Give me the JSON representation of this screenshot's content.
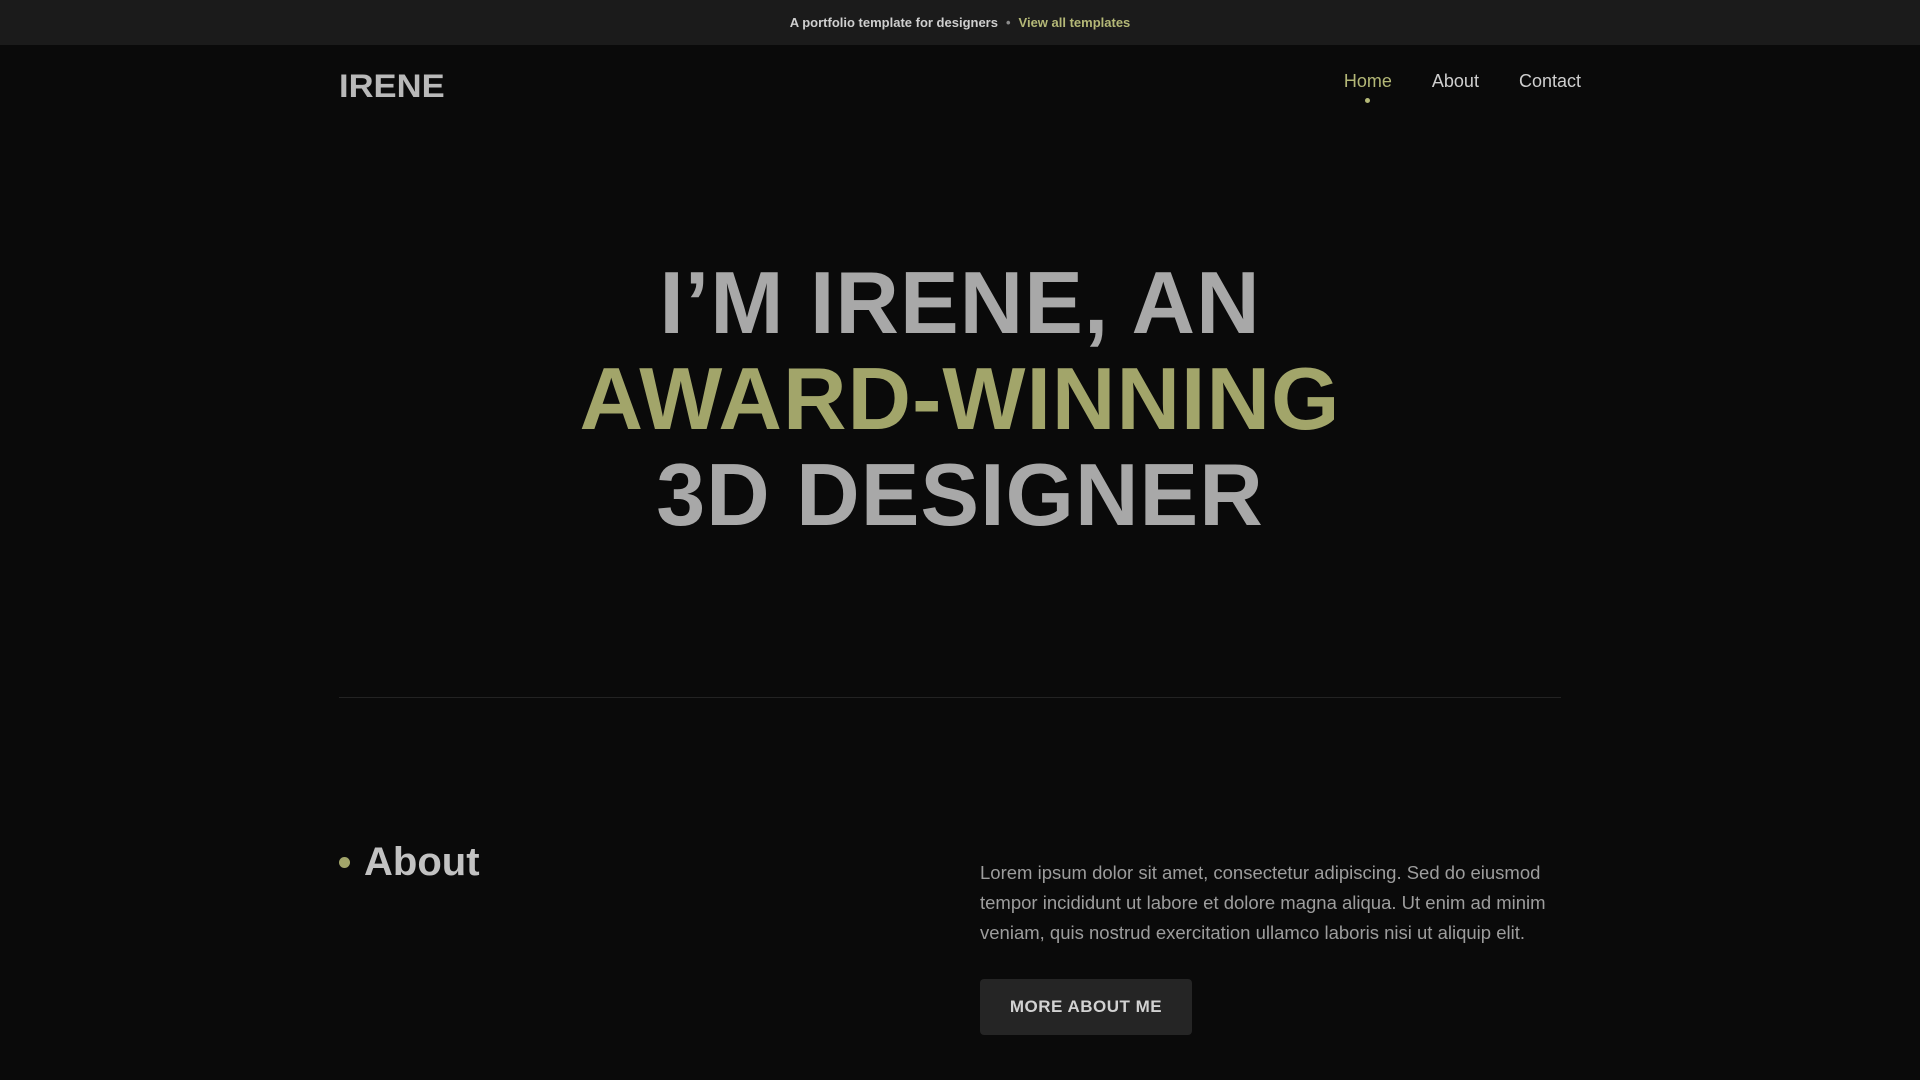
{
  "topbar": {
    "message": "A portfolio template for designers",
    "separator": "•",
    "link_label": "View all templates"
  },
  "header": {
    "logo": "IRENE",
    "nav": [
      {
        "label": "Home",
        "active": true
      },
      {
        "label": "About",
        "active": false
      },
      {
        "label": "Contact",
        "active": false
      }
    ]
  },
  "hero": {
    "line1": "I’M IRENE, AN",
    "line2": "AWARD-WINNING",
    "line3": "3D DESIGNER"
  },
  "about": {
    "heading": "About",
    "body": "Lorem ipsum dolor sit amet, consectetur adipiscing. Sed do eiusmod tempor incididunt ut labore et dolore magna aliqua. Ut enim ad minim veniam, quis nostrud exercitation ullamco laboris nisi ut aliquip elit.",
    "button_label": "MORE ABOUT ME"
  },
  "colors": {
    "accent": "#a2a56a",
    "background": "#0a0a0a",
    "topbar_background": "#1b1b1b",
    "button_background": "#252525"
  }
}
